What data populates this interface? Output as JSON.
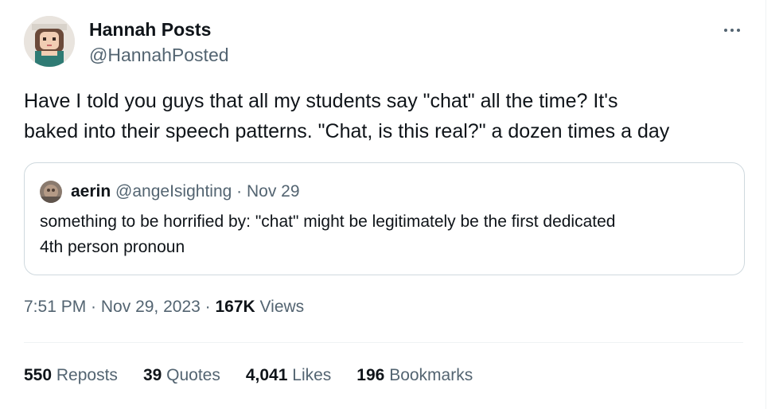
{
  "author": {
    "display_name": "Hannah Posts",
    "handle": "@HannahPosted"
  },
  "tweet": {
    "text_lines": [
      "Have I told you guys that all my students say \"chat\" all the time? It's",
      "baked into their speech patterns. \"Chat, is this real?\" a dozen times a day"
    ]
  },
  "quoted_tweet": {
    "display_name": "aerin",
    "handle": "@angeIsighting",
    "separator": " · ",
    "date": "Nov 29",
    "text_lines": [
      "something to be horrified by: \"chat\" might be legitimately be the first dedicated",
      "4th person pronoun"
    ]
  },
  "meta": {
    "time": "7:51 PM",
    "separator": " · ",
    "date": "Nov 29, 2023",
    "views_count": "167K",
    "views_label": "Views"
  },
  "stats": [
    {
      "count": "550",
      "label": "Reposts"
    },
    {
      "count": "39",
      "label": "Quotes"
    },
    {
      "count": "4,041",
      "label": "Likes"
    },
    {
      "count": "196",
      "label": "Bookmarks"
    }
  ],
  "icons": {
    "more": "more-horizontal-icon"
  },
  "colors": {
    "primary_text": "#0f1419",
    "secondary_text": "#536471",
    "border": "#cfd9de",
    "divider": "#eff3f4"
  }
}
